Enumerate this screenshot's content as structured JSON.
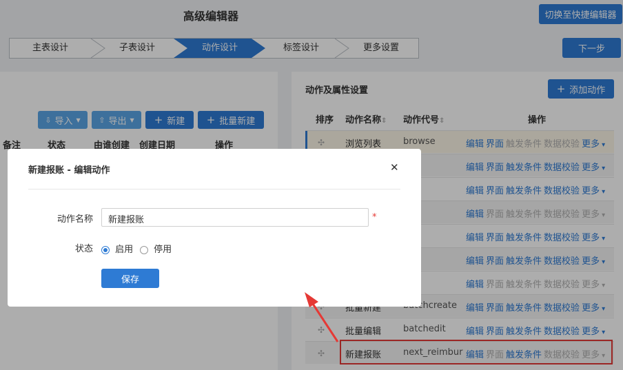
{
  "header": {
    "title": "高级编辑器",
    "switch_button": "切换至快捷编辑器"
  },
  "steps": [
    {
      "label": "主表设计",
      "active": false
    },
    {
      "label": "子表设计",
      "active": false
    },
    {
      "label": "动作设计",
      "active": true
    },
    {
      "label": "标签设计",
      "active": false
    },
    {
      "label": "更多设置",
      "active": false
    }
  ],
  "next_button": "下一步",
  "left_panel": {
    "toolbar": {
      "import": "导入",
      "export": "导出",
      "new": "新建",
      "batch_new": "批量新建"
    },
    "columns": [
      "备注",
      "状态",
      "由谁创建",
      "创建日期",
      "操作"
    ]
  },
  "right_panel": {
    "title": "动作及属性设置",
    "add_button": "添加动作",
    "columns": {
      "order": "排序",
      "name": "动作名称",
      "code": "动作代号",
      "ops": "操作"
    },
    "op_labels": {
      "edit": "编辑",
      "ui": "界面",
      "trigger": "触发条件",
      "validate": "数据校验",
      "more": "更多"
    },
    "rows": [
      {
        "name": "浏览列表",
        "code": "browse"
      },
      {
        "name": "",
        "code": "te"
      },
      {
        "name": "",
        "code": ""
      },
      {
        "name": "",
        "code": ""
      },
      {
        "name": "",
        "code": "te"
      },
      {
        "name": "",
        "code": ""
      },
      {
        "name": "",
        "code": "ort"
      },
      {
        "name": "批量新建",
        "code": "batchcreate"
      },
      {
        "name": "批量编辑",
        "code": "batchedit"
      },
      {
        "name": "新建报账",
        "code": "next_reimbur"
      }
    ]
  },
  "modal": {
    "title": "新建报账 - 编辑动作",
    "name_label": "动作名称",
    "name_value": "新建报账",
    "required_mark": "*",
    "status_label": "状态",
    "status_on": "启用",
    "status_off": "停用",
    "save_button": "保存"
  },
  "colors": {
    "primary": "#2e7bd4",
    "light": "#5aa6e6",
    "highlight": "#e53935"
  }
}
